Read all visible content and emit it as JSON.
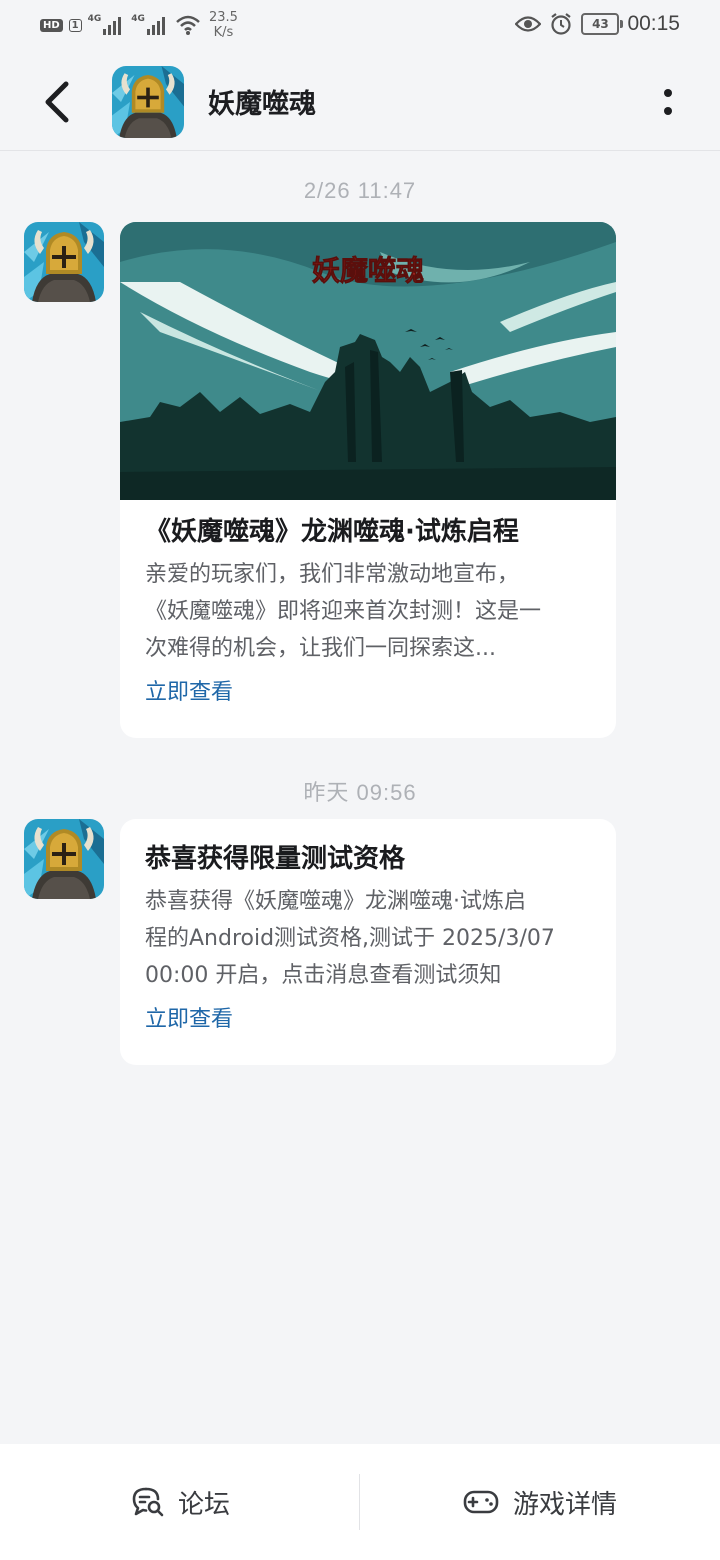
{
  "status_bar": {
    "hd": "HD",
    "sim": "1",
    "net1": "4G",
    "net2": "4G",
    "speed_value": "23.5",
    "speed_unit": "K/s",
    "battery": "43",
    "time": "00:15"
  },
  "header": {
    "title": "妖魔噬魂"
  },
  "messages": [
    {
      "timestamp": "2/26  11:47",
      "banner_text": "妖魔噬魂",
      "title": "《妖魔噬魂》龙渊噬魂·试炼启程",
      "lines": [
        "亲爱的玩家们，我们非常激动地宣布，",
        "《妖魔噬魂》即将迎来首次封测！这是一",
        "次难得的机会，让我们一同探索这..."
      ],
      "link": "立即查看"
    },
    {
      "timestamp": "昨天  09:56",
      "title": "恭喜获得限量测试资格",
      "lines": [
        "恭喜获得《妖魔噬魂》龙渊噬魂·试炼启",
        "程的Android测试资格,测试于 2025/3/07",
        "00:00 开启，点击消息查看测试须知"
      ],
      "link": "立即查看"
    }
  ],
  "bottom_bar": {
    "forum_label": "论坛",
    "detail_label": "游戏详情"
  },
  "icons": {
    "back": "chevron-left-icon",
    "more": "more-vertical-icon",
    "forum": "chat-search-icon",
    "detail": "gamepad-icon"
  }
}
